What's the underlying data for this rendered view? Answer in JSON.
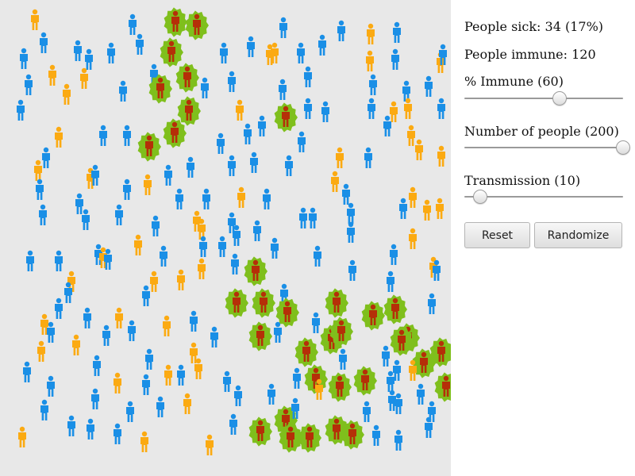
{
  "stats": {
    "people_sick": "People sick: 34 (17%)",
    "people_immune": "People immune: 120"
  },
  "sliders": [
    {
      "label": "% Immune (60)",
      "min": 0,
      "max": 100,
      "value": 60
    },
    {
      "label": "Number of people (200)",
      "min": 0,
      "max": 200,
      "value": 200
    },
    {
      "label": "Transmission (10)",
      "min": 0,
      "max": 100,
      "value": 10
    }
  ],
  "buttons": {
    "reset": "Reset",
    "randomize": "Randomize"
  },
  "colors": {
    "healthy": "#1a8fe6",
    "immune": "#fbaa12",
    "sick_body": "#b52f08",
    "sick_halo": "#7fbf1c",
    "background": "#e8e8e8"
  },
  "people": {
    "sick_count": 34,
    "immune_count": 120,
    "total": 200
  }
}
